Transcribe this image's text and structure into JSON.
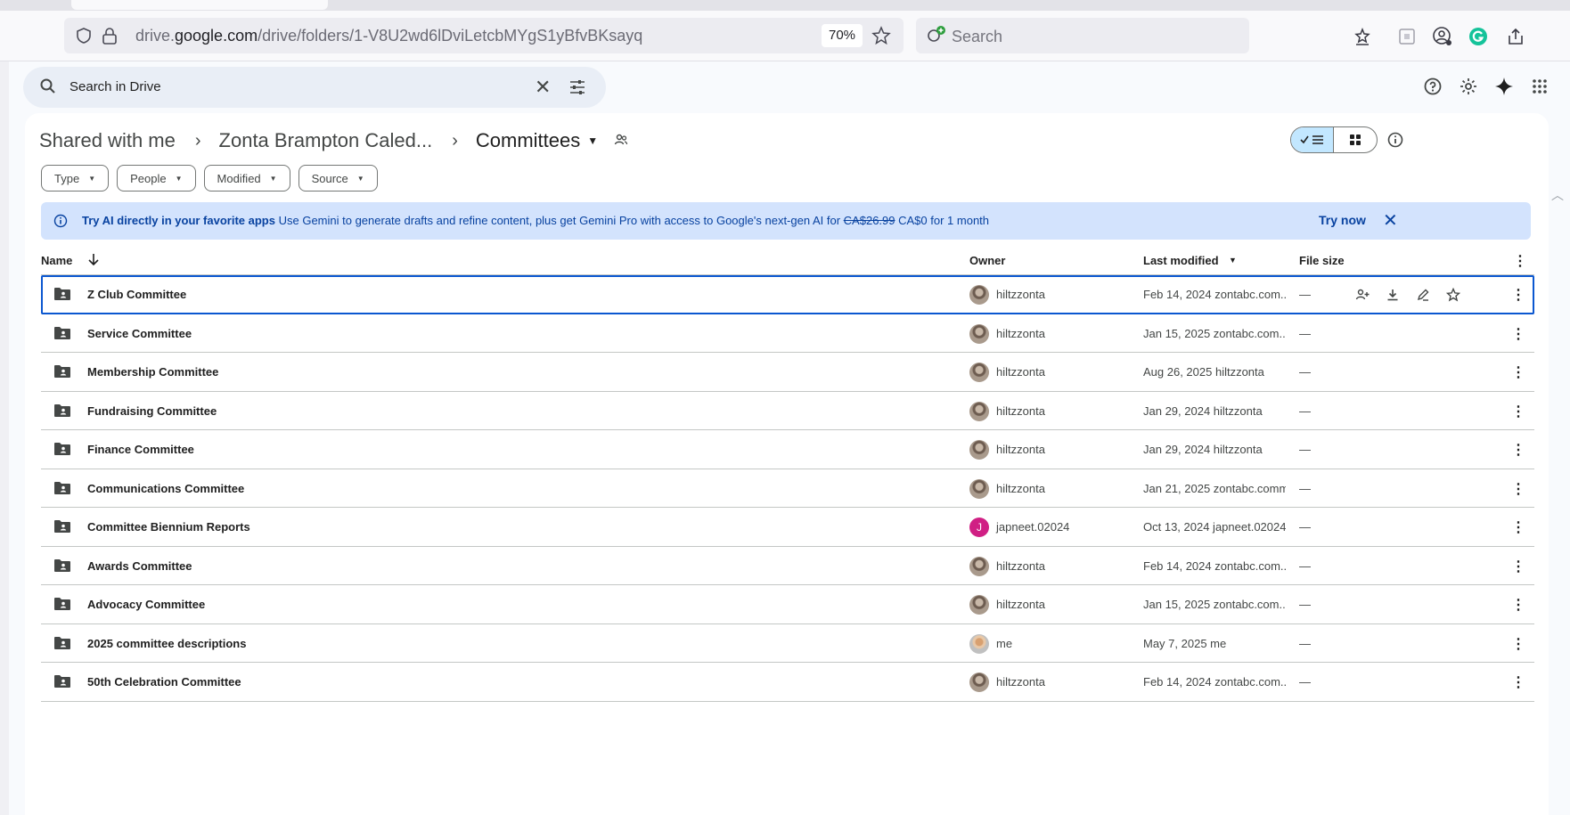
{
  "browser": {
    "url_prefix": "drive.",
    "url_domain": "google.com",
    "url_path": "/drive/folders/1-V8U2wd6lDviLetcbMYgS1yBfvBKsayq",
    "zoom": "70%",
    "search_placeholder": "Search"
  },
  "drive": {
    "search_placeholder": "Search in Drive",
    "breadcrumb": [
      "Shared with me",
      "Zonta Brampton Caled...",
      "Committees"
    ],
    "filters": [
      "Type",
      "People",
      "Modified",
      "Source"
    ],
    "banner": {
      "title": "Try AI directly in your favorite apps",
      "text": "Use Gemini to generate drafts and refine content, plus get Gemini Pro with access to Google's next-gen AI for",
      "old_price": "CA$26.99",
      "new_price": "CA$0 for 1 month",
      "action": "Try now"
    },
    "columns": {
      "name": "Name",
      "owner": "Owner",
      "last_modified": "Last modified",
      "file_size": "File size"
    },
    "rows": [
      {
        "name": "Z Club Committee",
        "owner": "hiltzzonta",
        "avatar": "photo",
        "modified": "Feb 14, 2024 zontabc.com...",
        "size": "—"
      },
      {
        "name": "Service Committee",
        "owner": "hiltzzonta",
        "avatar": "photo",
        "modified": "Jan 15, 2025 zontabc.com...",
        "size": "—"
      },
      {
        "name": "Membership Committee",
        "owner": "hiltzzonta",
        "avatar": "photo",
        "modified": "Aug 26, 2025 hiltzzonta",
        "size": "—"
      },
      {
        "name": "Fundraising Committee",
        "owner": "hiltzzonta",
        "avatar": "photo",
        "modified": "Jan 29, 2024 hiltzzonta",
        "size": "—"
      },
      {
        "name": "Finance Committee",
        "owner": "hiltzzonta",
        "avatar": "photo",
        "modified": "Jan 29, 2024 hiltzzonta",
        "size": "—"
      },
      {
        "name": "Communications Committee",
        "owner": "hiltzzonta",
        "avatar": "photo",
        "modified": "Jan 21, 2025 zontabc.comm...",
        "size": "—"
      },
      {
        "name": "Committee Biennium Reports",
        "owner": "japneet.02024",
        "avatar": "letter",
        "avatar_letter": "J",
        "modified": "Oct 13, 2024 japneet.02024",
        "size": "—"
      },
      {
        "name": "Awards Committee",
        "owner": "hiltzzonta",
        "avatar": "photo",
        "modified": "Feb 14, 2024 zontabc.com...",
        "size": "—"
      },
      {
        "name": "Advocacy Committee",
        "owner": "hiltzzonta",
        "avatar": "photo",
        "modified": "Jan 15, 2025 zontabc.com...",
        "size": "—"
      },
      {
        "name": "2025 committee descriptions",
        "owner": "me",
        "avatar": "me",
        "modified": "May 7, 2025 me",
        "size": "—"
      },
      {
        "name": "50th Celebration Committee",
        "owner": "hiltzzonta",
        "avatar": "photo",
        "modified": "Feb 14, 2024 zontabc.com...",
        "size": "—"
      }
    ]
  },
  "colors": {
    "accent": "#0b57d0",
    "banner_bg": "#d3e3fd",
    "toggle_on": "#c2e7ff",
    "avatar_letter_bg": "#d01f84"
  }
}
